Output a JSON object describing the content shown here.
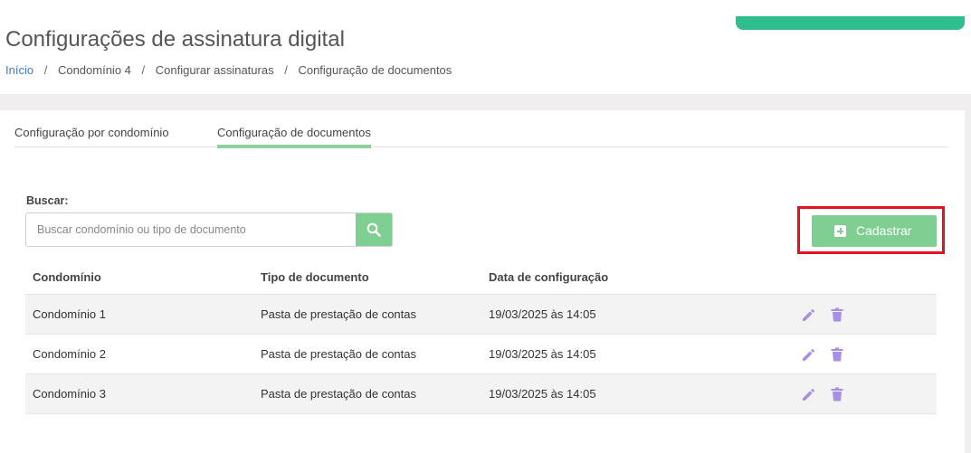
{
  "header": {
    "title": "Configurações de assinatura digital",
    "breadcrumb": [
      "Início",
      "Condomínio 4",
      "Configurar assinaturas",
      "Configuração de documentos"
    ]
  },
  "tabs": [
    {
      "label": "Configuração por condomínio",
      "active": false
    },
    {
      "label": "Configuração de documentos",
      "active": true
    }
  ],
  "search": {
    "label": "Buscar:",
    "placeholder": "Buscar condomínio ou tipo de documento",
    "value": ""
  },
  "actions": {
    "create_label": "Cadastrar"
  },
  "table": {
    "columns": [
      "Condomínio",
      "Tipo de documento",
      "Data de configuração"
    ],
    "rows": [
      {
        "condominio": "Condomínio 1",
        "tipo": "Pasta de prestação de contas",
        "data": "19/03/2025 às 14:05"
      },
      {
        "condominio": "Condomínio 2",
        "tipo": "Pasta de prestação de contas",
        "data": "19/03/2025 às 14:05"
      },
      {
        "condominio": "Condomínio 3",
        "tipo": "Pasta de prestação de contas",
        "data": "19/03/2025 às 14:05"
      }
    ]
  },
  "icons": {
    "search": "search-icon",
    "add": "plus-square-icon",
    "edit": "pencil-icon",
    "delete": "trash-icon"
  },
  "colors": {
    "accent_green": "#7fcf93",
    "top_bar": "#2fbf8f",
    "highlight": "#e0121f",
    "action_icon": "#a98ee6",
    "link": "#3a7bd5"
  }
}
